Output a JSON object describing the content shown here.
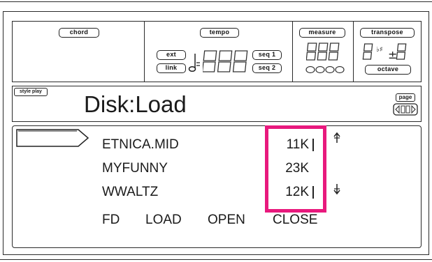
{
  "header": {
    "chord_label": "chord",
    "tempo_label": "tempo",
    "measure_label": "measure",
    "transpose_label": "transpose",
    "ext_label": "ext",
    "link_label": "link",
    "seq1_label": "seq 1",
    "seq2_label": "seq 2",
    "octave_label": "octave"
  },
  "mode": {
    "style_play_label": "style play",
    "page_title": "Disk:Load",
    "page_label": "page"
  },
  "files": [
    {
      "name": "ETNICA.MID",
      "size": "11K"
    },
    {
      "name": "MYFUNNY",
      "size": "23K"
    },
    {
      "name": "WWALTZ",
      "size": "12K"
    }
  ],
  "softkeys": {
    "fd": "FD",
    "load": "LOAD",
    "open": "OPEN",
    "close": "CLOSE"
  },
  "colors": {
    "highlight": "#e8197d",
    "line": "#2a2a2a"
  }
}
